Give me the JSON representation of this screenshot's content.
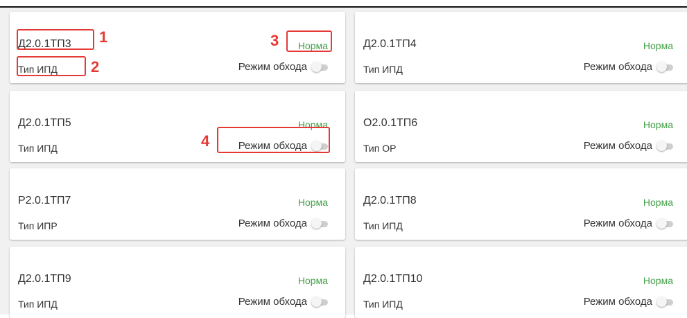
{
  "devices": [
    {
      "name": "Д2.0.1ТП3",
      "type": "Тип ИПД",
      "status": "Норма",
      "bypass_label": "Режим обхода",
      "bypass_on": false
    },
    {
      "name": "Д2.0.1ТП4",
      "type": "Тип ИПД",
      "status": "Норма",
      "bypass_label": "Режим обхода",
      "bypass_on": false
    },
    {
      "name": "Д2.0.1ТП5",
      "type": "Тип ИПД",
      "status": "Норма",
      "bypass_label": "Режим обхода",
      "bypass_on": false
    },
    {
      "name": "О2.0.1ТП6",
      "type": "Тип ОР",
      "status": "Норма",
      "bypass_label": "Режим обхода",
      "bypass_on": false
    },
    {
      "name": "Р2.0.1ТП7",
      "type": "Тип ИПР",
      "status": "Норма",
      "bypass_label": "Режим обхода",
      "bypass_on": false
    },
    {
      "name": "Д2.0.1ТП8",
      "type": "Тип ИПД",
      "status": "Норма",
      "bypass_label": "Режим обхода",
      "bypass_on": false
    },
    {
      "name": "Д2.0.1ТП9",
      "type": "Тип ИПД",
      "status": "Норма",
      "bypass_label": "Режим обхода",
      "bypass_on": false
    },
    {
      "name": "Д2.0.1ТП10",
      "type": "Тип ИПД",
      "status": "Норма",
      "bypass_label": "Режим обхода",
      "bypass_on": false
    }
  ],
  "annotations": {
    "one": "1",
    "two": "2",
    "three": "3",
    "four": "4"
  },
  "colors": {
    "status_ok": "#43a047",
    "annotation": "#e53935"
  }
}
